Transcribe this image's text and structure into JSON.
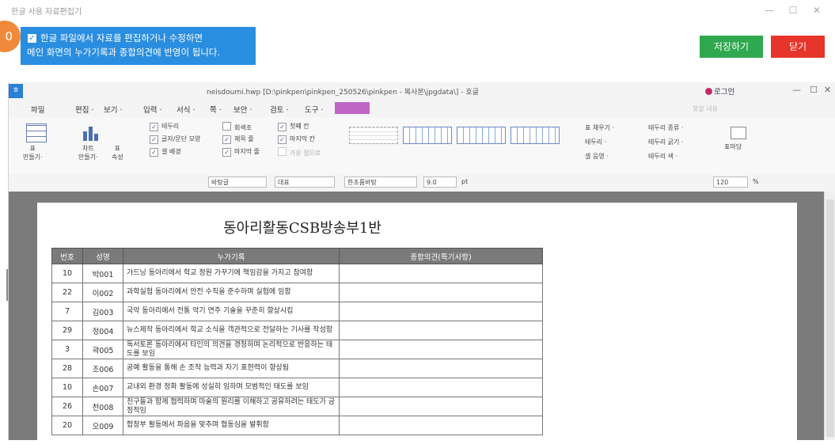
{
  "window": {
    "title": "한글 사용 자료편집기",
    "min": "—",
    "max": "☐",
    "close": "✕"
  },
  "marker": {
    "label": "0"
  },
  "banner": {
    "line1": "한글 파일에서 자료를 편집하거나 수정하면",
    "line2": "메인 화면의 누가기록과 종합의견에 반영이 됩니다.",
    "check": "✓"
  },
  "buttons": {
    "save": "저장하기",
    "close": "닫기"
  },
  "hwp": {
    "logo": "ㅎ",
    "title": "neisdoumi.hwp [D:\\pinkpen\\pinkpen_250526\\pinkpen - 복사본\\jpgdata\\] - 호글",
    "login": "로그인",
    "wbtns": [
      "—",
      "☐",
      "✕"
    ],
    "menus": [
      "파일",
      "편집 ·",
      "보기 ·",
      "입력 ·",
      "서식 ·",
      "쪽 ·",
      "보안 ·",
      "검토 ·",
      "도구 ·"
    ],
    "search_hint": "찾을 내용",
    "ribbon": {
      "table_make": "표\n만들기·",
      "chart_make": "차트\n만들기·",
      "table_prop": "표\n속성",
      "checks_col1": [
        "테두리",
        "글자/문단 모양",
        "셀 배경"
      ],
      "checks_col2": [
        "회색조",
        "제목 줄",
        "마지막 줄"
      ],
      "checks_col3": [
        "첫째 칸",
        "마지막 칸",
        "가운 점으로"
      ],
      "fill": "표 채우기 ·",
      "border": "테두리 ·",
      "cellcolor": "셀 음영 ·",
      "border_kind": "테두리 종류 ·",
      "border_width": "테두리 굵기 ·",
      "border_color": "테두리 색 ·",
      "tablemap": "표마당"
    },
    "toolbar": {
      "style": "바탕글",
      "lang": "대표",
      "font": "한초롬바탕",
      "size": "9.0",
      "unit": "pt",
      "zoom": "120",
      "zoom_unit": "%"
    }
  },
  "document": {
    "title": "동아리활동CSB방송부1반",
    "headers": [
      "번호",
      "성명",
      "누가기록",
      "종합의견(특기사항)"
    ],
    "rows": [
      {
        "no": "10",
        "name": "박001",
        "rec": "가드닝 동아리에서 학교 정원 가꾸기에 책임감을 가지고 참여함",
        "op": ""
      },
      {
        "no": "22",
        "name": "이002",
        "rec": "과학실험 동아리에서 안전 수칙을 준수하며 실험에 임함",
        "op": ""
      },
      {
        "no": "7",
        "name": "김003",
        "rec": "국악 동아리에서 전통 악기 연주 기술을 꾸준히 향상시킴",
        "op": ""
      },
      {
        "no": "29",
        "name": "정004",
        "rec": "뉴스제작 동아리에서 학교 소식을 객관적으로 전달하는 기사를 작성함",
        "op": ""
      },
      {
        "no": "3",
        "name": "곽005",
        "rec": "독서토론 동아리에서 타인의 의견을 경청하며 논리적으로 반응하는 태도를 보임",
        "op": ""
      },
      {
        "no": "28",
        "name": "조006",
        "rec": "공예 활동을 통해 손 조작 능력과 자기 표현력이 향상됨",
        "op": ""
      },
      {
        "no": "10",
        "name": "손007",
        "rec": "교내외 환경 정화 활동에 성실히 임하며 모범적인 태도를 보임",
        "op": ""
      },
      {
        "no": "26",
        "name": "천008",
        "rec": "친구들과 함께 협력하며 마술의 원리를 이해하고 공유하려는 태도가 긍정적임",
        "op": ""
      },
      {
        "no": "20",
        "name": "오009",
        "rec": "합창부 활동에서 파음을 맞추며 협동심을 발휘함",
        "op": ""
      }
    ]
  }
}
